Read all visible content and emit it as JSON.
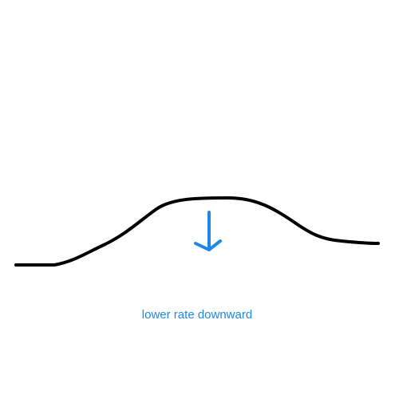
{
  "caption": {
    "text": "lower rate downward",
    "color": "#1e88e5"
  },
  "curve": {
    "color": "#000000"
  },
  "arrow": {
    "icon": "arrow-down-icon",
    "color": "#1e88e5"
  }
}
